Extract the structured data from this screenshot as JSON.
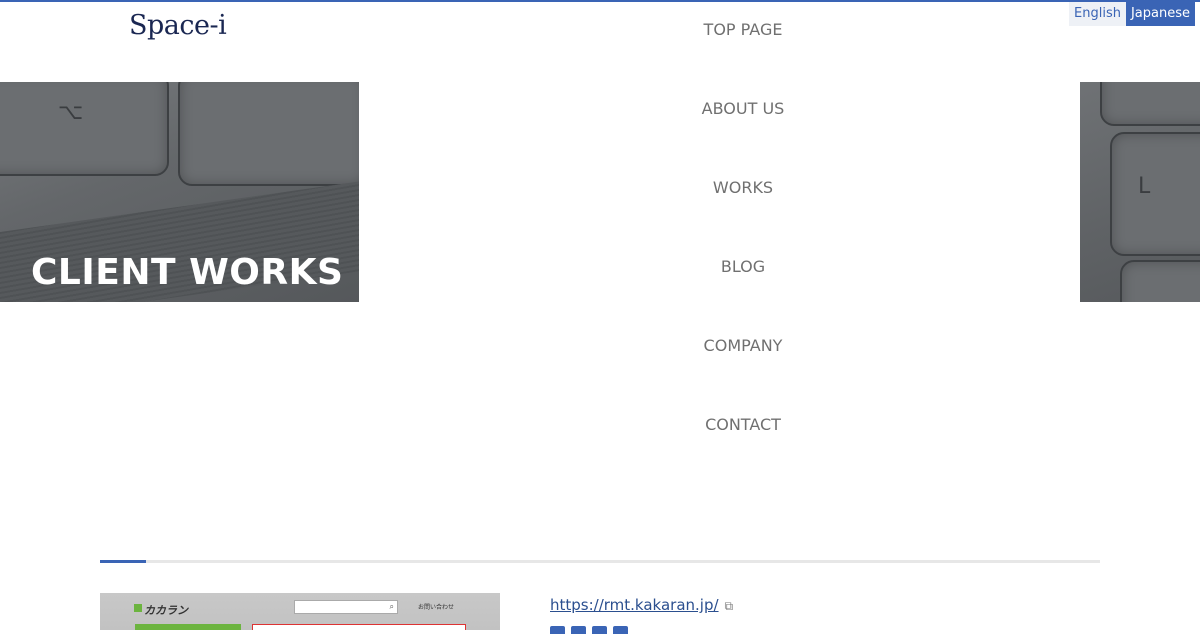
{
  "header": {
    "logo": "Space-i",
    "languages": {
      "english": "English",
      "japanese": "Japanese"
    }
  },
  "hero": {
    "title": "CLIENT WORKS"
  },
  "nav": {
    "items": [
      {
        "label": "TOP PAGE"
      },
      {
        "label": "ABOUT US"
      },
      {
        "label": "WORKS"
      },
      {
        "label": "BLOG"
      },
      {
        "label": "COMPANY"
      },
      {
        "label": "CONTACT"
      }
    ]
  },
  "work": {
    "url": "https://rmt.kakaran.jp/",
    "thumbnail": {
      "brand": "カカラン",
      "contact": "お問い合わせ"
    }
  },
  "colors": {
    "accent": "#3a64b5",
    "nav_text": "#707070",
    "logo": "#1a2752"
  }
}
